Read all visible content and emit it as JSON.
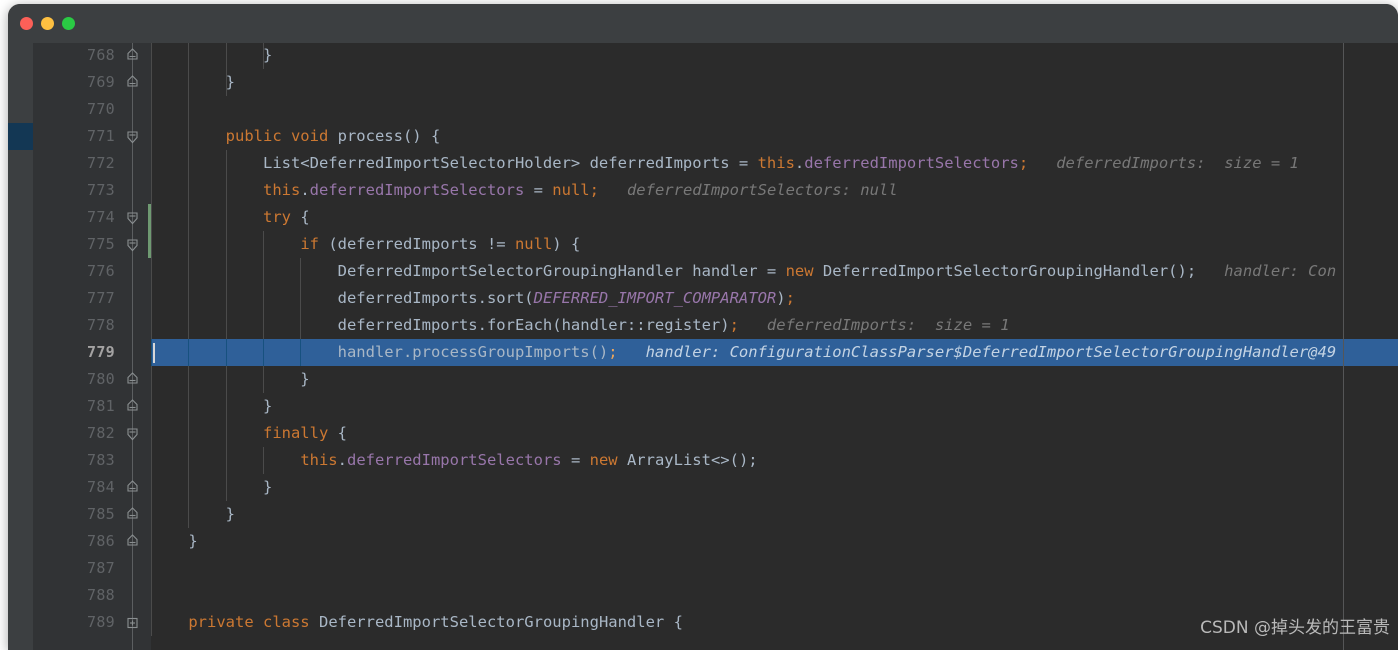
{
  "window": {
    "titlebar": {
      "buttons": [
        {
          "name": "close-button",
          "icon": "close-traffic-light",
          "color": "#fc6058"
        },
        {
          "name": "minimize-button",
          "icon": "minimize-traffic-light",
          "color": "#fec041"
        },
        {
          "name": "maximize-button",
          "icon": "maximize-traffic-light",
          "color": "#2aca44"
        }
      ]
    },
    "background": "#2b2b2b",
    "chrome_background": "#3c3f41"
  },
  "editor": {
    "gutter_background": "#313335",
    "vcs_strip_background": "#3c3f41",
    "vcs_marker_color": "#133754",
    "selection_color": "#2f6099",
    "current_line": 779,
    "first_line": 768,
    "last_line": 789,
    "line_height": 27,
    "language": "java",
    "lines": [
      {
        "number": "768",
        "fold": "collapse-up",
        "indent_guides": [
          0,
          1,
          2,
          3
        ],
        "tokens": [
          {
            "t": "            }",
            "c": "brc"
          }
        ]
      },
      {
        "number": "769",
        "fold": "collapse-up",
        "indent_guides": [
          0,
          1,
          2
        ],
        "tokens": [
          {
            "t": "        }",
            "c": "brc"
          }
        ]
      },
      {
        "number": "770",
        "fold": "none",
        "indent_guides": [
          0,
          1
        ],
        "tokens": []
      },
      {
        "number": "771",
        "fold": "collapse-down",
        "indent_guides": [
          0,
          1
        ],
        "vcs_changed": true,
        "tokens": [
          {
            "t": "        ",
            "c": "plain"
          },
          {
            "t": "public void ",
            "c": "kw"
          },
          {
            "t": "process",
            "c": "ident"
          },
          {
            "t": "() {",
            "c": "brc"
          }
        ]
      },
      {
        "number": "772",
        "fold": "none",
        "indent_guides": [
          0,
          1,
          2
        ],
        "tokens": [
          {
            "t": "            List<DeferredImportSelectorHolder> deferredImports = ",
            "c": "ident"
          },
          {
            "t": "this",
            "c": "kw"
          },
          {
            "t": ".",
            "c": "ident"
          },
          {
            "t": "deferredImportSelectors",
            "c": "fld"
          },
          {
            "t": ";",
            "c": "semi"
          },
          {
            "t": "   deferredImports:  size = 1",
            "c": "hint"
          }
        ]
      },
      {
        "number": "773",
        "fold": "none",
        "indent_guides": [
          0,
          1,
          2
        ],
        "tokens": [
          {
            "t": "            ",
            "c": "plain"
          },
          {
            "t": "this",
            "c": "kw"
          },
          {
            "t": ".",
            "c": "ident"
          },
          {
            "t": "deferredImportSelectors",
            "c": "fld"
          },
          {
            "t": " = ",
            "c": "ident"
          },
          {
            "t": "null",
            "c": "kw"
          },
          {
            "t": ";",
            "c": "semi"
          },
          {
            "t": "   deferredImportSelectors: null",
            "c": "hint"
          }
        ]
      },
      {
        "number": "774",
        "fold": "collapse-down",
        "indent_guides": [
          0,
          1,
          2
        ],
        "change_bar": true,
        "tokens": [
          {
            "t": "            ",
            "c": "plain"
          },
          {
            "t": "try",
            "c": "kw"
          },
          {
            "t": " {",
            "c": "brc"
          }
        ]
      },
      {
        "number": "775",
        "fold": "collapse-down",
        "indent_guides": [
          0,
          1,
          2,
          3
        ],
        "change_bar": true,
        "tokens": [
          {
            "t": "                ",
            "c": "plain"
          },
          {
            "t": "if",
            "c": "kw"
          },
          {
            "t": " (deferredImports != ",
            "c": "ident"
          },
          {
            "t": "null",
            "c": "kw"
          },
          {
            "t": ") {",
            "c": "brc"
          }
        ]
      },
      {
        "number": "776",
        "fold": "none",
        "indent_guides": [
          0,
          1,
          2,
          3,
          4
        ],
        "tokens": [
          {
            "t": "                    DeferredImportSelectorGroupingHandler handler = ",
            "c": "ident"
          },
          {
            "t": "new",
            "c": "kw"
          },
          {
            "t": " DeferredImportSelectorGroupingHandler();",
            "c": "ident"
          },
          {
            "t": "   handler: Con",
            "c": "hint"
          }
        ]
      },
      {
        "number": "777",
        "fold": "none",
        "indent_guides": [
          0,
          1,
          2,
          3,
          4
        ],
        "tokens": [
          {
            "t": "                    deferredImports.sort(",
            "c": "ident"
          },
          {
            "t": "DEFERRED_IMPORT_COMPARATOR",
            "c": "cfld"
          },
          {
            "t": ")",
            "c": "ident"
          },
          {
            "t": ";",
            "c": "semi"
          }
        ]
      },
      {
        "number": "778",
        "fold": "none",
        "indent_guides": [
          0,
          1,
          2,
          3,
          4
        ],
        "tokens": [
          {
            "t": "                    deferredImports.forEach(handler::register)",
            "c": "ident"
          },
          {
            "t": ";",
            "c": "semi"
          },
          {
            "t": "   deferredImports:  size = 1",
            "c": "hint"
          }
        ]
      },
      {
        "number": "779",
        "fold": "none",
        "selected": true,
        "caret": true,
        "indent_guides": [
          0,
          1,
          2,
          3,
          4
        ],
        "tokens": [
          {
            "t": "                    handler.processGroupImports()",
            "c": "ident"
          },
          {
            "t": ";",
            "c": "semi"
          },
          {
            "t": "   handler: ConfigurationClassParser$DeferredImportSelectorGroupingHandler@49",
            "c": "hint"
          }
        ]
      },
      {
        "number": "780",
        "fold": "collapse-up",
        "indent_guides": [
          0,
          1,
          2,
          3
        ],
        "tokens": [
          {
            "t": "                }",
            "c": "brc"
          }
        ]
      },
      {
        "number": "781",
        "fold": "collapse-up",
        "indent_guides": [
          0,
          1,
          2
        ],
        "tokens": [
          {
            "t": "            }",
            "c": "brc"
          }
        ]
      },
      {
        "number": "782",
        "fold": "collapse-down",
        "indent_guides": [
          0,
          1,
          2
        ],
        "tokens": [
          {
            "t": "            ",
            "c": "plain"
          },
          {
            "t": "finally",
            "c": "kw"
          },
          {
            "t": " {",
            "c": "brc"
          }
        ]
      },
      {
        "number": "783",
        "fold": "none",
        "indent_guides": [
          0,
          1,
          2,
          3
        ],
        "tokens": [
          {
            "t": "                ",
            "c": "plain"
          },
          {
            "t": "this",
            "c": "kw"
          },
          {
            "t": ".",
            "c": "ident"
          },
          {
            "t": "deferredImportSelectors",
            "c": "fld"
          },
          {
            "t": " = ",
            "c": "ident"
          },
          {
            "t": "new",
            "c": "kw"
          },
          {
            "t": " ArrayList<>();",
            "c": "ident"
          }
        ]
      },
      {
        "number": "784",
        "fold": "collapse-up",
        "indent_guides": [
          0,
          1,
          2
        ],
        "tokens": [
          {
            "t": "            }",
            "c": "brc"
          }
        ]
      },
      {
        "number": "785",
        "fold": "collapse-up",
        "indent_guides": [
          0,
          1
        ],
        "tokens": [
          {
            "t": "        }",
            "c": "brc"
          }
        ]
      },
      {
        "number": "786",
        "fold": "collapse-up",
        "indent_guides": [
          0
        ],
        "tokens": [
          {
            "t": "    }",
            "c": "brc"
          }
        ]
      },
      {
        "number": "787",
        "fold": "none",
        "indent_guides": [
          0
        ],
        "tokens": []
      },
      {
        "number": "788",
        "fold": "none",
        "indent_guides": [
          0
        ],
        "tokens": []
      },
      {
        "number": "789",
        "fold": "expand-box",
        "indent_guides": [
          0
        ],
        "tokens": [
          {
            "t": "    ",
            "c": "plain"
          },
          {
            "t": "private class ",
            "c": "kw"
          },
          {
            "t": "DeferredImportSelectorGroupingHandler",
            "c": "ident"
          },
          {
            "t": " {",
            "c": "brc"
          }
        ]
      }
    ]
  },
  "watermark": {
    "text": "CSDN @掉头发的王富贵"
  }
}
